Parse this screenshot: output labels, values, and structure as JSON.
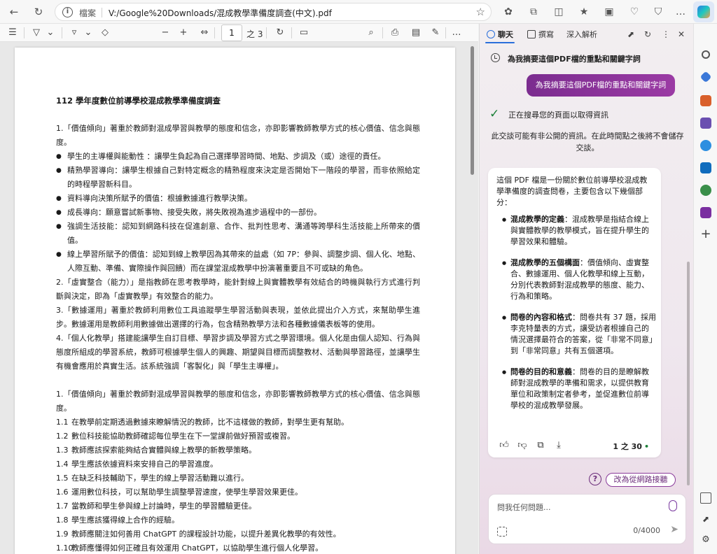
{
  "browser": {
    "file_chip": "檔案",
    "url": "V:/Google%20Downloads/混成教學準備度調查(中文).pdf"
  },
  "pdf_toolbar": {
    "page_current": "1",
    "page_total": "之 3"
  },
  "document": {
    "title": "112 學年度數位前導學校混成教學準備度調查",
    "section1": [
      {
        "kind": "para",
        "text": "1.「價值傾向」著重於教師對混成學習與教學的態度和信念，亦即影響教師教學方式的核心價值、信念與態度。"
      },
      {
        "kind": "bullet",
        "text": "學生的主導權與能動性 ：讓學生負起為自己選擇學習時間、地點、步調及（或）途徑的責任。"
      },
      {
        "kind": "bullet",
        "text": "精熟學習導向：讓學生根據自己對特定概念的精熟程度來決定是否開始下一階段的學習，而非依照給定的時程學習新科目。"
      },
      {
        "kind": "bullet",
        "text": "資料導向決策所賦予的價值：根據數據進行教學決策。"
      },
      {
        "kind": "bullet",
        "text": "成長導向：願意嘗試新事物、接受失敗，將失敗視為進步過程中的一部份。"
      },
      {
        "kind": "bullet",
        "text": "強調生活技能：認知到網路科技在促進創意、合作、批判性思考、溝通等跨學科生活技能上所帶來的價值。"
      },
      {
        "kind": "bullet",
        "text": "線上學習所賦予的價值：認知到線上教學因為其帶來的益處（如 7P：參與、調整步調、個人化、地點、人際互動、準備、實際操作與回饋）而在課堂混成教學中扮演著重要且不可或缺的角色。"
      },
      {
        "kind": "para",
        "text": "2.「虛實整合（能力）」是指教師在思考教學時，能針對線上與實體教學有效結合的時機與執行方式進行判斷與決定，即為「虛實教學」有效整合的能力。"
      },
      {
        "kind": "para",
        "text": "3.「數據運用」著重於教師利用數位工具追蹤學生學習活動與表現，並依此提出介入方式，來幫助學生進步。數據運用是教師利用數據做出選擇的行為，包含精熟教學方法和各種數據儀表板等的使用。"
      },
      {
        "kind": "para",
        "text": "4.「個人化教學」搭建能讓學生自訂目標、學習步調及學習方式之學習環境。個人化是由個人認知、行為與態度所組成的學習系統，教師可根據學生個人的興趣、期望與目標而調整教材、活動與學習路徑，並讓學生有機會應用於真實生活。該系統強調「客製化」與「學生主導權」。"
      }
    ],
    "section2_intro": "1.「價值傾向」著重於教師對混成學習與教學的態度和信念，亦即影響教師教學方式的核心價值、信念與態度。",
    "section2_items": [
      {
        "n": "1.1",
        "text": "在教學前定期透過數據來瞭解情況的教師，比不這樣做的教師，對學生更有幫助。"
      },
      {
        "n": "1.2",
        "text": "數位科技能協助教師確認每位學生在下一堂課前做好預習或複習。"
      },
      {
        "n": "1.3",
        "text": "教師應該探索能夠結合實體與線上教學的新教學策略。"
      },
      {
        "n": "1.4",
        "text": "學生應該依據資料來安排自己的學習進度。"
      },
      {
        "n": "1.5",
        "text": "在缺乏科技輔助下，學生的線上學習活動難以進行。"
      },
      {
        "n": "1.6",
        "text": "運用數位科技，可以幫助學生調整學習速度，使學生學習效果更佳。"
      },
      {
        "n": "1.7",
        "text": "當教師和學生參與線上討論時，學生的學習體驗更佳。"
      },
      {
        "n": "1.8",
        "text": "學生應該獲得線上合作的經驗。"
      },
      {
        "n": "1.9",
        "text": "教師應關注如何善用 ChatGPT 的課程設計功能，以提升差異化教學的有效性。"
      },
      {
        "n": "1.10",
        "text": "教師應懂得如何正確且有效運用 ChatGPT，以協助學生進行個人化學習。"
      }
    ]
  },
  "copilot": {
    "tabs": [
      "聊天",
      "撰寫",
      "深入解析"
    ],
    "history_title": "為我摘要這個PDF檔的重點和關鍵字詞",
    "user_prompt": "為我摘要這個PDF檔的重點和關鍵字詞",
    "search_status": "正在搜尋您的頁面以取得資訊",
    "privacy_note": "此交談可能有非公開的資訊。在此時間點之後將不會儲存交談。",
    "answer_intro": "這個 PDF 檔是一份關於數位前導學校混成教學準備度的調查問卷，主要包含以下幾個部分：",
    "answer_points": [
      {
        "label": "混成教學的定義",
        "text": "：混成教學是指結合線上與實體教學的教學模式，旨在提升學生的學習效果和體驗。"
      },
      {
        "label": "混成教學的五個構面",
        "text": "：價值傾向、虛實整合、數據運用、個人化教學和線上互動，分別代表教師對混成教學的態度、能力、行為和策略。"
      },
      {
        "label": "問卷的內容和格式",
        "text": "：問卷共有 37 題，採用李克特量表的方式，讓受訪者根據自己的情況選擇最符合的答案，從「非常不同意」到「非常同意」共有五個選項。"
      },
      {
        "label": "問卷的目的和意義",
        "text": "：問卷的目的是瞭解教師對混成教學的準備和需求，以提供教育單位和政策制定者參考，並促進數位前導學校的混成教學發展。"
      }
    ],
    "response_count": "1 之 30",
    "web_button": "改為從網路接聽",
    "input_placeholder": "問我任何問題...",
    "char_count": "0/4000"
  },
  "colors": {
    "accent_purple": "#8a3a9a",
    "success_green": "#1a7f37",
    "tab_blue": "#2a6fdb"
  }
}
